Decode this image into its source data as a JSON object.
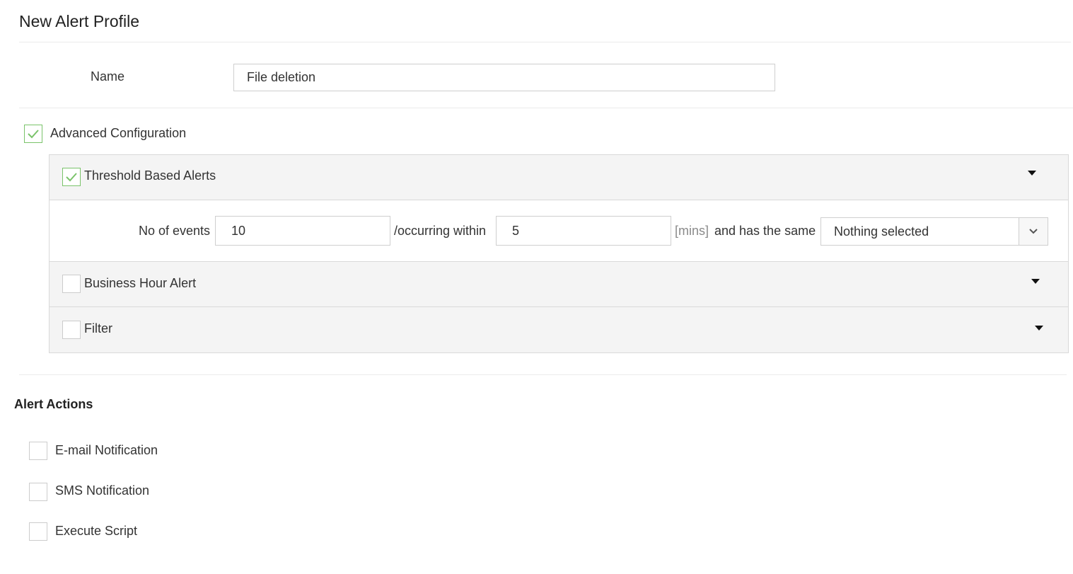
{
  "page": {
    "title": "New Alert Profile"
  },
  "name_field": {
    "label": "Name",
    "value": "File deletion"
  },
  "advanced": {
    "label": "Advanced Configuration",
    "checked": true
  },
  "threshold": {
    "label": "Threshold Based Alerts",
    "checked": true,
    "events_label": "No of events",
    "events_value": "10",
    "occurring_label": "/occurring within",
    "occurring_value": "5",
    "unit": "[mins]",
    "same_label": "and has the same",
    "same_select": "Nothing selected"
  },
  "business_hour": {
    "label": "Business Hour Alert",
    "checked": false
  },
  "filter": {
    "label": "Filter",
    "checked": false
  },
  "alert_actions": {
    "title": "Alert Actions",
    "items": [
      {
        "label": "E-mail Notification",
        "checked": false
      },
      {
        "label": "SMS Notification",
        "checked": false
      },
      {
        "label": "Execute Script",
        "checked": false
      }
    ]
  },
  "colors": {
    "check_green": "#7ac36a",
    "panel_bg": "#f4f4f4"
  }
}
